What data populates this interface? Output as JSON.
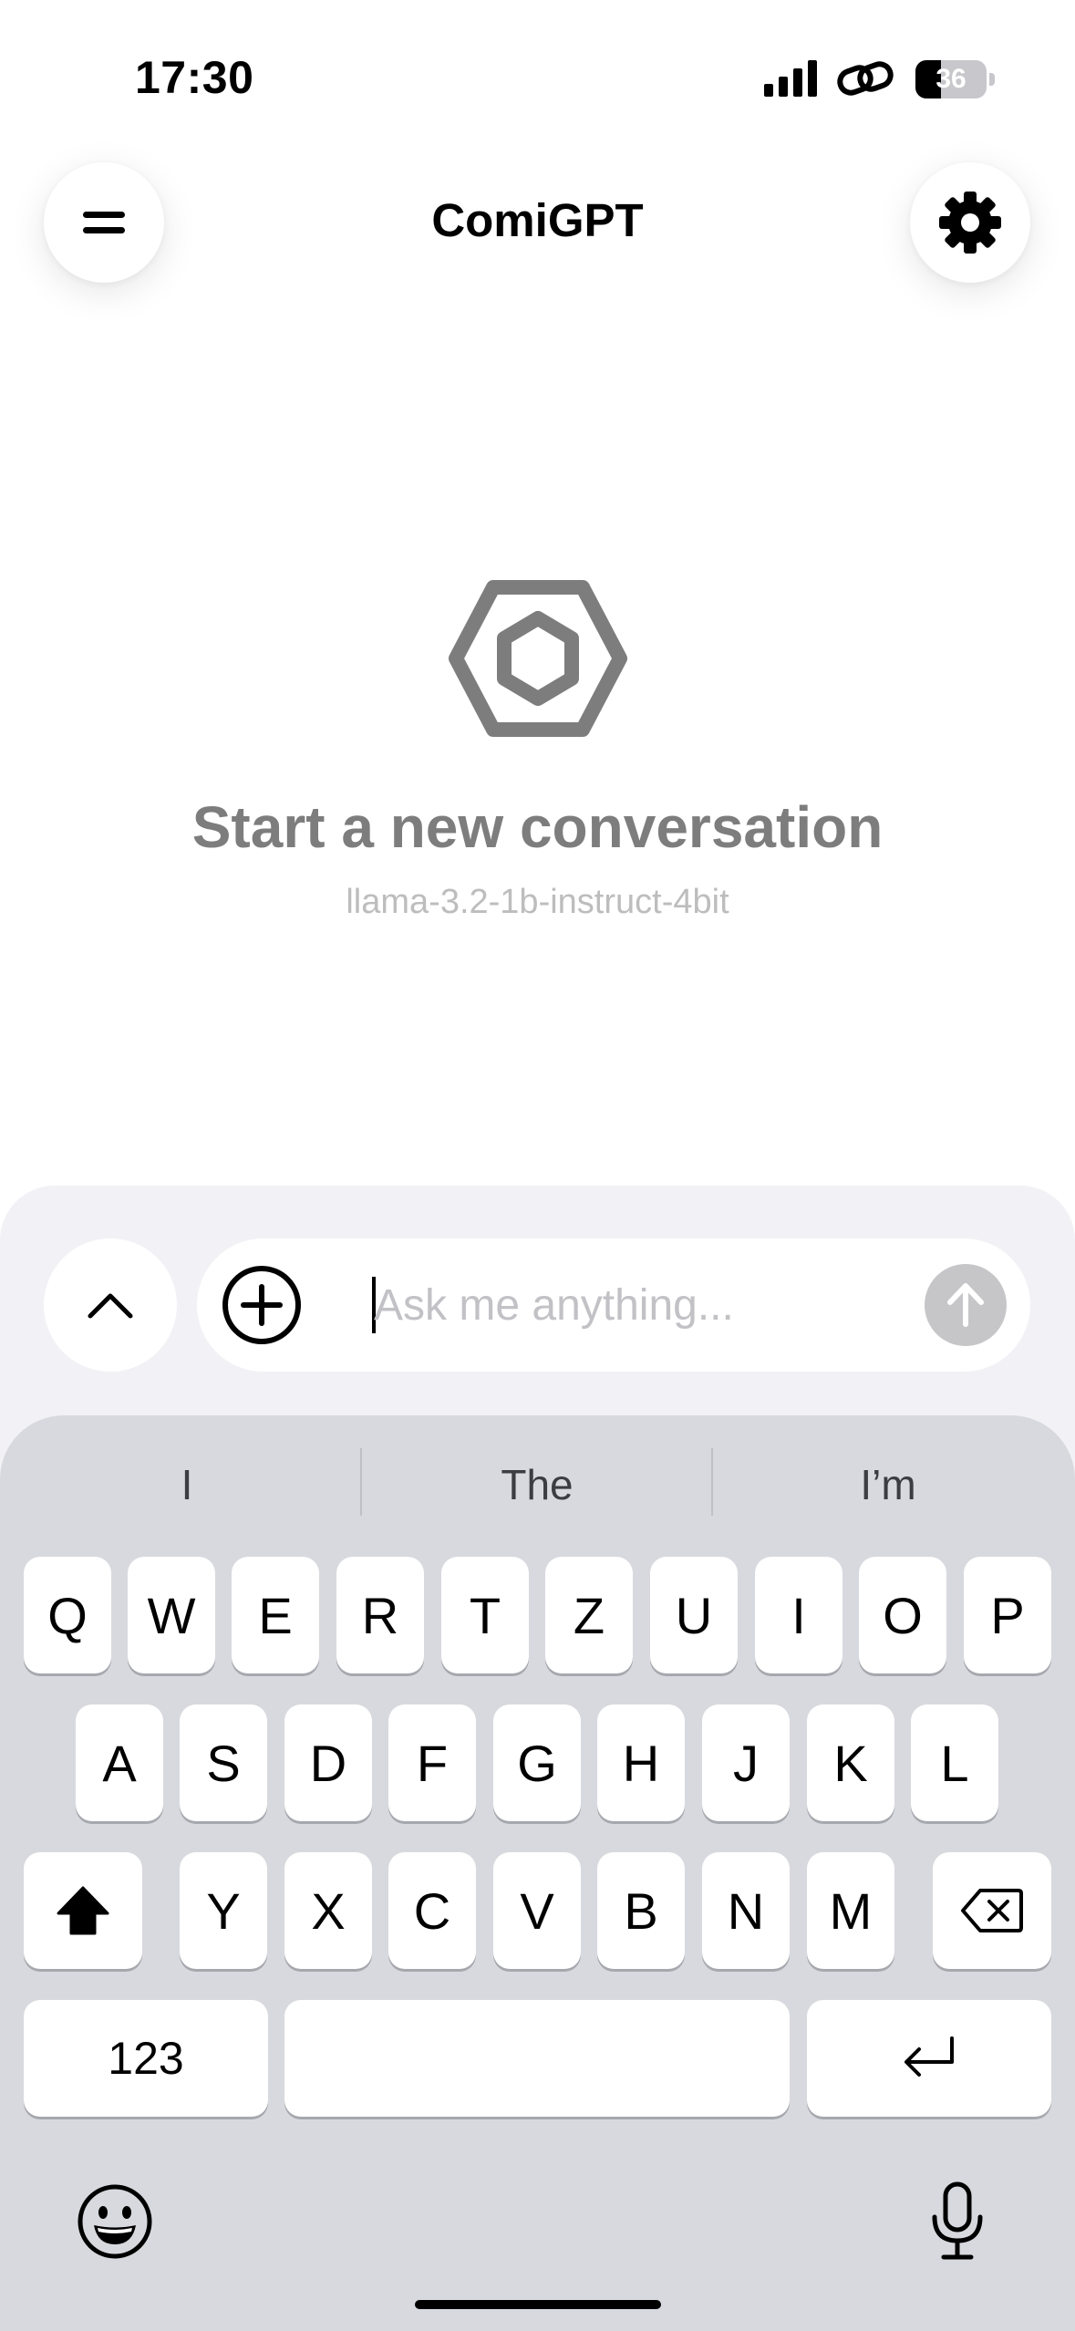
{
  "status_bar": {
    "time": "17:30",
    "battery_level": "36",
    "battery_fraction": 0.36,
    "signal_icon": "cellular-signal-icon",
    "link_icon": "link-icon"
  },
  "header": {
    "title": "ComiGPT",
    "menu_icon": "menu-icon",
    "settings_icon": "gear-icon"
  },
  "empty_state": {
    "logo_icon": "hexagon-logo-icon",
    "title": "Start a new conversation",
    "model_name": "llama-3.2-1b-instruct-4bit"
  },
  "composer": {
    "placeholder": "Ask me anything...",
    "value": "",
    "expand_icon": "chevron-up-icon",
    "attach_icon": "plus-circle-icon",
    "send_icon": "arrow-up-icon"
  },
  "keyboard": {
    "suggestions": [
      "I",
      "The",
      "I’m"
    ],
    "row1": [
      "Q",
      "W",
      "E",
      "R",
      "T",
      "Z",
      "U",
      "I",
      "O",
      "P"
    ],
    "row2": [
      "A",
      "S",
      "D",
      "F",
      "G",
      "H",
      "J",
      "K",
      "L"
    ],
    "row3": [
      "Y",
      "X",
      "C",
      "V",
      "B",
      "N",
      "M"
    ],
    "numbers_label": "123",
    "shift_icon": "shift-icon",
    "delete_icon": "delete-icon",
    "return_icon": "return-icon",
    "emoji_icon": "emoji-icon",
    "mic_icon": "microphone-icon"
  },
  "colors": {
    "background": "#ffffff",
    "muted_title": "#7d7d7d",
    "keyboard_bg": "#d8d9de",
    "composer_bg": "#f2f2f6",
    "send_disabled": "#c6c6c8"
  }
}
